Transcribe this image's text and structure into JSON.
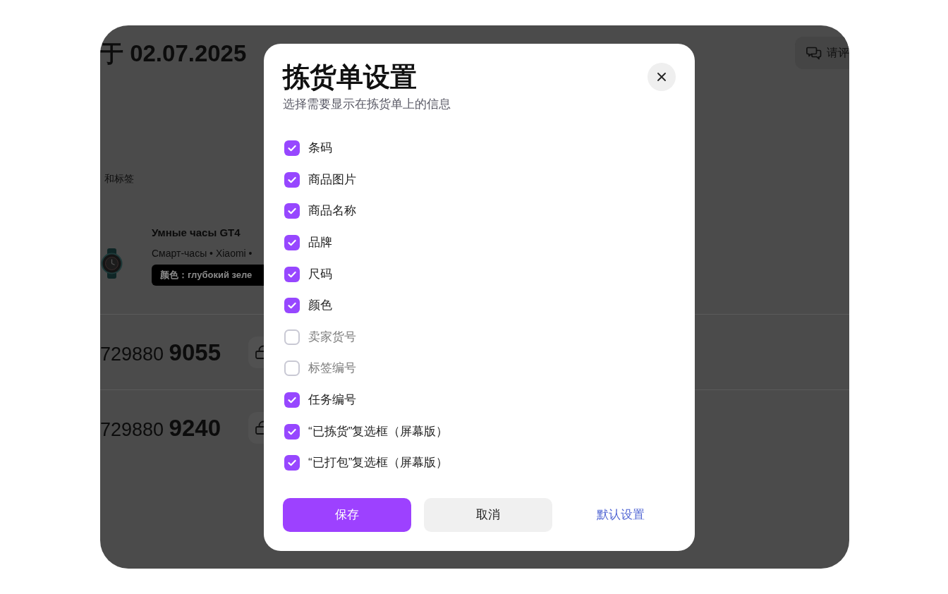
{
  "background_page": {
    "title": "于 02.07.2025",
    "chat_button": {
      "label": "请评"
    },
    "section_label": "和标签",
    "product": {
      "name": "Умные часы GT4",
      "subtitle": "Смарт-часы • Xiaomi •",
      "tag": "颜色：глубокий зеле"
    },
    "orders": [
      {
        "number": "729880 **9055**"
      },
      {
        "number": "729880 **9240**"
      }
    ]
  },
  "dialog": {
    "title": "拣货单设置",
    "subtitle": "选择需要显示在拣货单上的信息",
    "options": [
      {
        "label": "条码",
        "checked": true
      },
      {
        "label": "商品图片",
        "checked": true
      },
      {
        "label": "商品名称",
        "checked": true
      },
      {
        "label": "品牌",
        "checked": true
      },
      {
        "label": "尺码",
        "checked": true
      },
      {
        "label": "颜色",
        "checked": true
      },
      {
        "label": "卖家货号",
        "checked": false
      },
      {
        "label": "标签编号",
        "checked": false
      },
      {
        "label": "任务编号",
        "checked": true
      },
      {
        "label": "“已拣货”复选框（屏幕版）",
        "checked": true
      },
      {
        "label": "“已打包”复选框（屏幕版）",
        "checked": true
      }
    ],
    "buttons": [
      {
        "label": "保存",
        "kind": "primary"
      },
      {
        "label": "取消",
        "kind": "secondary"
      },
      {
        "label": "默认设置",
        "kind": "link"
      }
    ]
  }
}
